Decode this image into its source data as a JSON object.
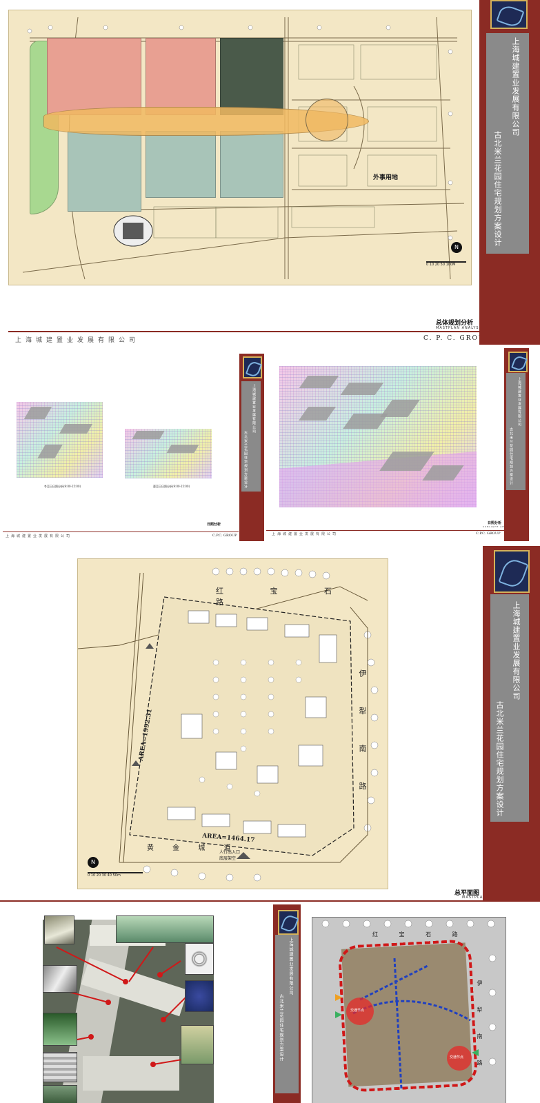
{
  "company": "上海城建置业发展有限公司",
  "project": "古北米兰花园住宅规划方案设计",
  "brand": "C. P. C.   GROUP",
  "brand_short": "C.P.C. GROUP",
  "footer_company": "上海城建置业发展有限公司",
  "board1": {
    "title": "总体规划分析",
    "subtitle": "MASTPLAN ANALYSIS",
    "label_foreign": "外事用地",
    "scale": "0 10 20    50     100M",
    "north": "N"
  },
  "board2": {
    "plot_caption_left": "冬至日日照分析(9:00-15:00)",
    "plot_caption_mid": "夏至日日照分析(9:00-15:00)",
    "caption_left_title": "日照分析",
    "caption_right_title": "日照分析",
    "caption_right_sub": "SUNLIGHT ANALYSIS"
  },
  "board3": {
    "title": "总平面图",
    "subtitle": "MASTPLAN",
    "road_top": "红 宝 石 路",
    "road_right": "伊 犁 南 路",
    "road_bottom": "黄 金 城 道",
    "area_left": "AREA=1992.31",
    "area_bottom": "AREA=1464.17",
    "entrance": "人行出入口\n底层架空",
    "scale": "0  10  20  30  40  50m",
    "north": "N"
  },
  "board4": {
    "node_left": "交通节点",
    "node_right": "交通节点",
    "road_top": "红 宝 石 路",
    "road_right": "伊 犁 南 路"
  },
  "colors": {
    "sidebar_dark": "#8b2b24",
    "sidebar_grey": "#8a8a8a",
    "plan_bg": "#f3e7c5",
    "zone_red": "#e8a092",
    "zone_green": "#a8c4b8",
    "zone_orange": "#f0b860",
    "zone_lime": "#a8d890"
  }
}
